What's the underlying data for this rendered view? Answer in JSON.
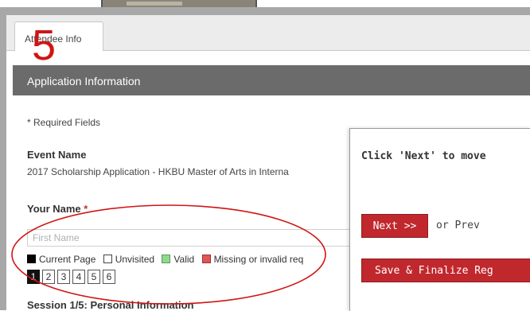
{
  "tab": {
    "label": "Attendee Info"
  },
  "annotation": {
    "step_number": "5",
    "color": "#d11414"
  },
  "section": {
    "title": "Application Information"
  },
  "form": {
    "required_note": "* Required Fields",
    "event_name_label": "Event Name",
    "event_name_value": "2017 Scholarship Application - HKBU Master of Arts in Interna",
    "your_name_label": "Your Name",
    "required_star": "*",
    "first_name_placeholder": "First Name"
  },
  "legend": {
    "current": "Current Page",
    "unvisited": "Unvisited",
    "valid": "Valid",
    "missing": "Missing or invalid req",
    "colors": {
      "current": "#000000",
      "unvisited": "#ffffff",
      "valid": "#8fd98f",
      "missing": "#e05555"
    }
  },
  "pages": [
    "1",
    "2",
    "3",
    "4",
    "5",
    "6"
  ],
  "current_page": 1,
  "session_title": "Session 1/5: Personal Information",
  "popup": {
    "message": "Click 'Next' to move",
    "next_button": "Next >>",
    "or_prev": "or Prev",
    "save_button": "Save & Finalize Reg"
  },
  "colors": {
    "button_red": "#c0282d",
    "section_bar": "#6b6b6b"
  }
}
